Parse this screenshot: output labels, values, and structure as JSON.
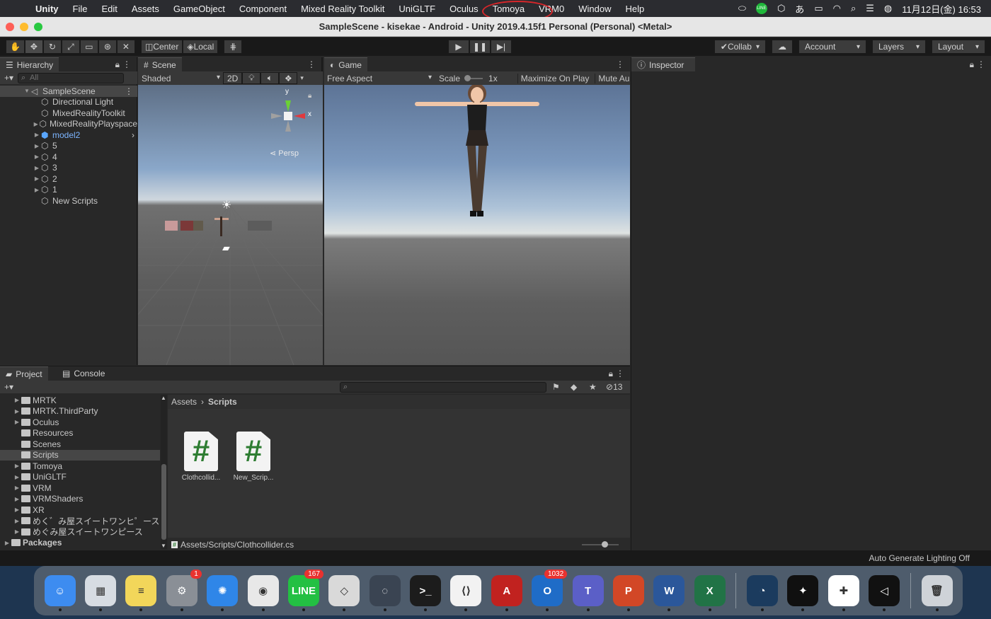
{
  "menubar": {
    "items": [
      "Unity",
      "File",
      "Edit",
      "Assets",
      "GameObject",
      "Component",
      "Mixed Reality Toolkit",
      "UniGLTF",
      "Oculus",
      "Tomoya",
      "VRM0",
      "Window",
      "Help"
    ],
    "clock": "11月12日(金)  16:53",
    "ime": "あ",
    "status_icons": [
      "battery-icon",
      "wifi-icon",
      "search-icon",
      "control-center-icon",
      "siri-icon"
    ]
  },
  "window": {
    "title": "SampleScene - kisekae - Android - Unity 2019.4.15f1 Personal (Personal) <Metal>"
  },
  "toolbar": {
    "center": "Center",
    "local": "Local",
    "collab": "Collab",
    "account": "Account",
    "layers": "Layers",
    "layout": "Layout"
  },
  "hierarchy": {
    "tab": "Hierarchy",
    "search_placeholder": "All",
    "scene": "SampleScene",
    "items": [
      "Directional Light",
      "MixedRealityToolkit",
      "MixedRealityPlayspace",
      "model2",
      "5",
      "4",
      "3",
      "2",
      "1",
      "New Scripts"
    ]
  },
  "scene": {
    "tab": "Scene",
    "shading": "Shaded",
    "mode": "2D",
    "persp": "Persp",
    "axis_y": "y",
    "axis_x": "x"
  },
  "game": {
    "tab": "Game",
    "aspect": "Free Aspect",
    "scale_label": "Scale",
    "scale_value": "1x",
    "maximize": "Maximize On Play",
    "mute": "Mute Au"
  },
  "inspector": {
    "tab": "Inspector"
  },
  "project": {
    "tab": "Project",
    "console_tab": "Console",
    "hidden_count": "13",
    "folders": [
      "MRTK",
      "MRTK.ThirdParty",
      "Oculus",
      "Resources",
      "Scenes",
      "Scripts",
      "Tomoya",
      "UniGLTF",
      "VRM",
      "VRMShaders",
      "XR",
      "めく゛み屋スイートワンヒ゜ース",
      "めぐみ屋スイートワンピース",
      "Packages"
    ],
    "breadcrumb_root": "Assets",
    "breadcrumb_current": "Scripts",
    "files": [
      {
        "name": "Clothcollid...",
        "glyph": "#"
      },
      {
        "name": "New_Scrip...",
        "glyph": "#"
      }
    ],
    "path": "Assets/Scripts/Clothcollider.cs"
  },
  "statusbar": {
    "text": "Auto Generate Lighting Off"
  },
  "dock": {
    "apps": [
      {
        "name": "finder",
        "color": "#3d8cf0",
        "glyph": "☺",
        "badge": ""
      },
      {
        "name": "launchpad",
        "color": "#d7dce2",
        "glyph": "▦",
        "badge": ""
      },
      {
        "name": "notes",
        "color": "#f2d65a",
        "glyph": "≡",
        "badge": ""
      },
      {
        "name": "system-preferences",
        "color": "#8a8f96",
        "glyph": "⚙",
        "badge": "1"
      },
      {
        "name": "safari",
        "color": "#2f86e8",
        "glyph": "✺",
        "badge": ""
      },
      {
        "name": "chrome",
        "color": "#e8e8e8",
        "glyph": "◉",
        "badge": ""
      },
      {
        "name": "line",
        "color": "#23c043",
        "glyph": "LINE",
        "badge": "167"
      },
      {
        "name": "unity-hub",
        "color": "#d9d9d9",
        "glyph": "◇",
        "badge": ""
      },
      {
        "name": "progress-app",
        "color": "#3a4452",
        "glyph": "◌",
        "badge": ""
      },
      {
        "name": "terminal",
        "color": "#1c1c1c",
        "glyph": ">_",
        "badge": ""
      },
      {
        "name": "vscode",
        "color": "#f2f2f2",
        "glyph": "⟨⟩",
        "badge": ""
      },
      {
        "name": "acrobat",
        "color": "#c1221f",
        "glyph": "A",
        "badge": ""
      },
      {
        "name": "outlook",
        "color": "#1f6cc7",
        "glyph": "O",
        "badge": "1032"
      },
      {
        "name": "teams",
        "color": "#5b5fc7",
        "glyph": "T",
        "badge": ""
      },
      {
        "name": "powerpoint",
        "color": "#d24726",
        "glyph": "P",
        "badge": ""
      },
      {
        "name": "word",
        "color": "#2b579a",
        "glyph": "W",
        "badge": ""
      },
      {
        "name": "excel",
        "color": "#217346",
        "glyph": "X",
        "badge": ""
      },
      {
        "name": "steam",
        "color": "#1b3b5e",
        "glyph": "◔",
        "badge": ""
      },
      {
        "name": "unreal-app",
        "color": "#101010",
        "glyph": "✦",
        "badge": ""
      },
      {
        "name": "slack",
        "color": "#ffffff",
        "glyph": "✚",
        "badge": ""
      },
      {
        "name": "unity",
        "color": "#111111",
        "glyph": "◁",
        "badge": ""
      },
      {
        "name": "trash",
        "color": "#cfd3d8",
        "glyph": "🗑",
        "badge": ""
      }
    ]
  }
}
